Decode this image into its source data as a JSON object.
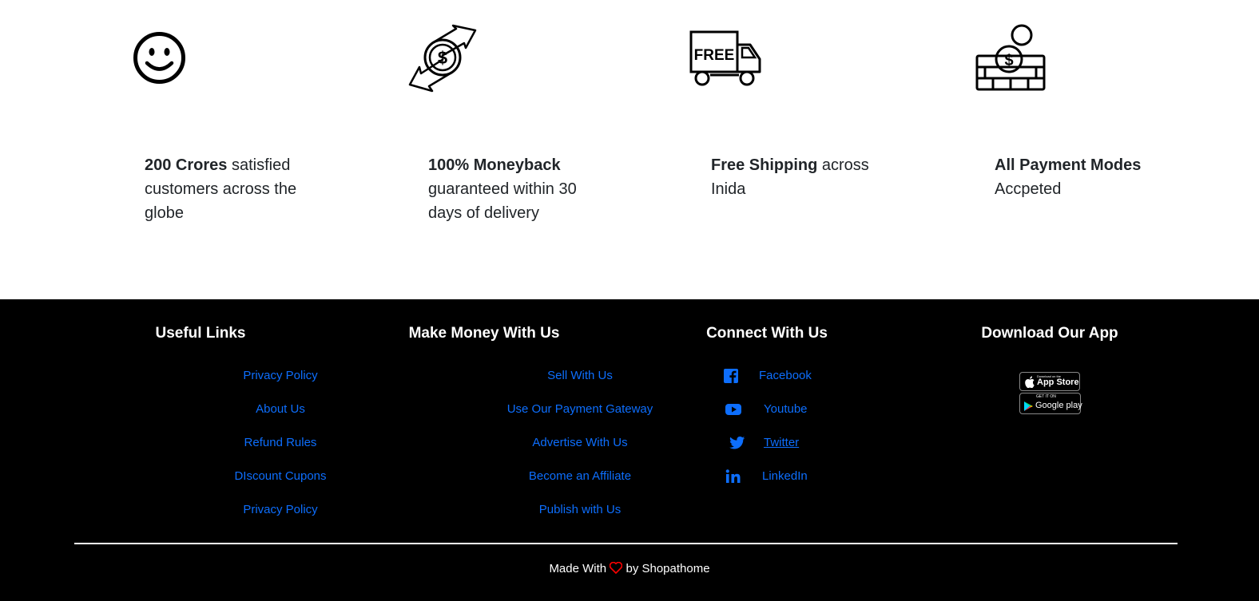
{
  "features": [
    {
      "bold": "200 Crores",
      "line1_rest": " satisfied",
      "line2": "customers across the",
      "line3": "globe",
      "icon": "smiley-icon"
    },
    {
      "bold": "100% Moneyback",
      "line1_rest": "",
      "line2": "guaranteed within 30",
      "line3": "days of delivery",
      "icon": "money-exchange-icon"
    },
    {
      "bold": "Free Shipping",
      "line1_rest": " across",
      "line2": "Inida",
      "line3": "",
      "icon": "free-delivery-truck-icon",
      "truck_text": "FREE"
    },
    {
      "bold": "All Payment Modes",
      "line1_rest": "",
      "line2": "Accpeted",
      "line3": "",
      "icon": "coins-wallet-icon"
    }
  ],
  "footer": {
    "useful_links": {
      "title": "Useful Links",
      "items": [
        "Privacy Policy",
        "About Us",
        "Refund Rules",
        "DIscount Cupons",
        "Privacy Policy"
      ]
    },
    "make_money": {
      "title": "Make Money With Us",
      "items": [
        "Sell With Us",
        "Use Our Payment Gateway",
        "Advertise With Us",
        "Become an Affiliate",
        "Publish with Us"
      ]
    },
    "connect": {
      "title": "Connect With Us",
      "items": [
        {
          "label": "Facebook",
          "icon": "facebook-icon"
        },
        {
          "label": "Youtube",
          "icon": "youtube-icon"
        },
        {
          "label": " Twitter",
          "icon": "twitter-icon"
        },
        {
          "label": "LinkedIn",
          "icon": "linkedin-icon"
        }
      ]
    },
    "download": {
      "title": "Download Our App",
      "app_store_small": "Download on the",
      "app_store": "App Store",
      "google_play_small": "GET IT ON",
      "google_play": "Google play"
    },
    "made_with_prefix": "Made With",
    "made_with_suffix": "by Shopathome"
  },
  "colors": {
    "link": "#0d6efd",
    "heart": "#ff0000",
    "footer_bg": "#000000"
  }
}
